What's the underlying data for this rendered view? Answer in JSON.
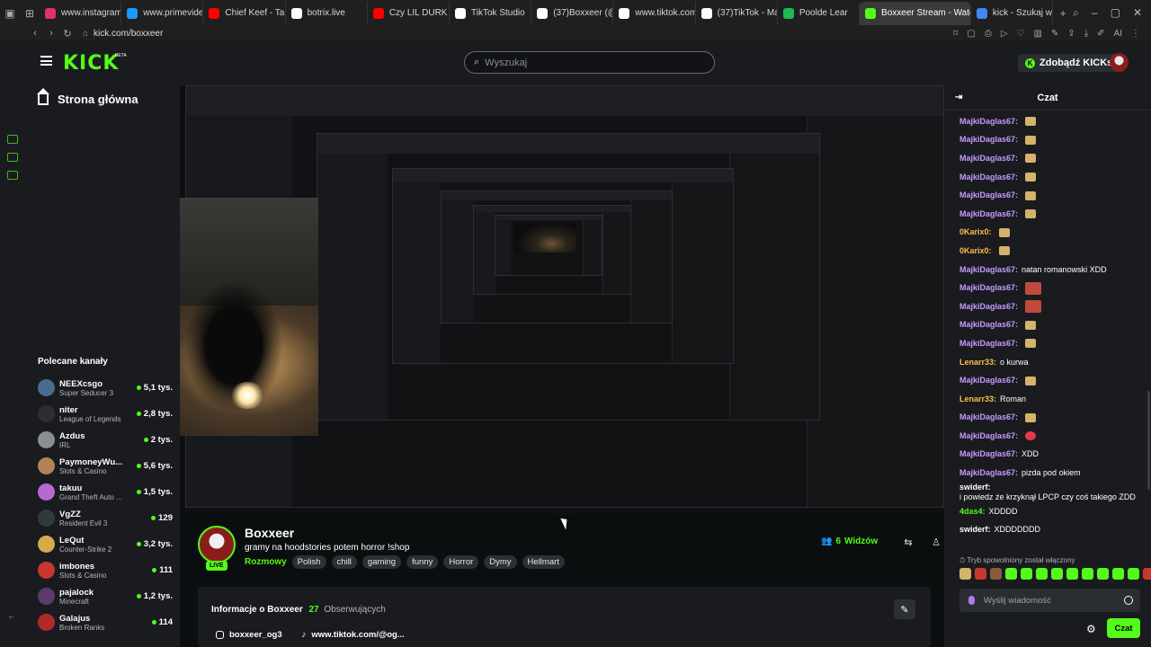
{
  "browser": {
    "tabs": [
      {
        "label": "www.instagram",
        "color": "#e1306c",
        "active": false
      },
      {
        "label": "www.primevide",
        "color": "#1a98ff",
        "active": false
      },
      {
        "label": "Chief Keef - Tal",
        "color": "#ff0000",
        "active": false
      },
      {
        "label": "botrix.live",
        "color": "#ffffff",
        "active": false
      },
      {
        "label": "Czy LIL DURK z",
        "color": "#ff0000",
        "active": false
      },
      {
        "label": "TikTok Studio",
        "color": "#ffffff",
        "active": false
      },
      {
        "label": "(37)Boxxeer (@",
        "color": "#ffffff",
        "active": false
      },
      {
        "label": "www.tiktok.com",
        "color": "#ffffff",
        "active": false
      },
      {
        "label": "(37)TikTok - Ma",
        "color": "#ffffff",
        "active": false
      },
      {
        "label": "Poolde Lear",
        "color": "#1db954",
        "active": false
      },
      {
        "label": "Boxxeer Stream - Watch L",
        "color": "#53fc18",
        "active": true
      },
      {
        "label": "kick - Szukaj w",
        "color": "#4285f4",
        "active": false
      }
    ],
    "url": "kick.com/boxxeer",
    "ext_ai": "AI"
  },
  "header": {
    "logo": "KICK",
    "logo_beta": "BETA",
    "search_placeholder": "Wyszukaj",
    "get_kicks": "Zdobądź KICKs",
    "kicks_k": "K"
  },
  "sidebar": {
    "home": "Strona główna",
    "recommended_title": "Polecane kanały",
    "channels": [
      {
        "name": "NEEXcsgo",
        "category": "Super Seducer 3",
        "viewers": "5,1 tys.",
        "color": "#4a6c8f"
      },
      {
        "name": "niter",
        "category": "League of Legends",
        "viewers": "2,8 tys.",
        "color": "#2e2e2e"
      },
      {
        "name": "Azdus",
        "category": "IRL",
        "viewers": "2 tys.",
        "color": "#8b8f93"
      },
      {
        "name": "PaymoneyWu...",
        "category": "Slots & Casino",
        "viewers": "5,6 tys.",
        "color": "#b0835a"
      },
      {
        "name": "takuu",
        "category": "Grand Theft Auto ...",
        "viewers": "1,5 tys.",
        "color": "#b46ad1"
      },
      {
        "name": "VgZZ",
        "category": "Resident Evil 3",
        "viewers": "129",
        "color": "#2f3a40"
      },
      {
        "name": "LeQut",
        "category": "Counter-Strike 2",
        "viewers": "3,2 tys.",
        "color": "#d9a94a"
      },
      {
        "name": "imbones",
        "category": "Slots & Casino",
        "viewers": "111",
        "color": "#c7372f"
      },
      {
        "name": "pajalock",
        "category": "Minecraft",
        "viewers": "1,2 tys.",
        "color": "#5b3a6e"
      },
      {
        "name": "Galajus",
        "category": "Broken Ranks",
        "viewers": "114",
        "color": "#b02a2a"
      }
    ]
  },
  "stream": {
    "streamer": "Boxxeer",
    "title": "gramy na hoodstories  potem  horror !shop",
    "live": "LIVE",
    "category": "Rozmowy",
    "tags": [
      "Polish",
      "chill",
      "gaming",
      "funny",
      "Horror",
      "Dymy",
      "Hellmart"
    ],
    "viewers": "6",
    "viewers_label": "Widzów",
    "about_title": "Informacje o Boxxeer",
    "followers": "27",
    "followers_label": "Obserwujących",
    "instagram": "boxxeer_og3",
    "tiktok": "www.tiktok.com/@og..."
  },
  "chat": {
    "title": "Czat",
    "messages": [
      {
        "user": "MajkiDaglas67:",
        "text": "",
        "color": "#c69bff",
        "emote": "gold"
      },
      {
        "user": "MajkiDaglas67:",
        "text": "",
        "color": "#c69bff",
        "emote": "gold"
      },
      {
        "user": "MajkiDaglas67:",
        "text": "",
        "color": "#c69bff",
        "emote": "gold"
      },
      {
        "user": "MajkiDaglas67:",
        "text": "",
        "color": "#c69bff",
        "emote": "gold"
      },
      {
        "user": "MajkiDaglas67:",
        "text": "",
        "color": "#c69bff",
        "emote": "gold"
      },
      {
        "user": "MajkiDaglas67:",
        "text": "",
        "color": "#c69bff",
        "emote": "gold"
      },
      {
        "user": "0Karix0:",
        "text": "",
        "color": "#ffbd44",
        "emote": "gold"
      },
      {
        "user": "0Karix0:",
        "text": "",
        "color": "#ffbd44",
        "emote": "gold"
      },
      {
        "user": "MajkiDaglas67:",
        "text": "natan romanowski XDD",
        "color": "#c69bff",
        "emote": ""
      },
      {
        "user": "MajkiDaglas67:",
        "text": "",
        "color": "#c69bff",
        "emote": "red"
      },
      {
        "user": "MajkiDaglas67:",
        "text": "",
        "color": "#c69bff",
        "emote": "red"
      },
      {
        "user": "MajkiDaglas67:",
        "text": "",
        "color": "#c69bff",
        "emote": "gold"
      },
      {
        "user": "MajkiDaglas67:",
        "text": "",
        "color": "#c69bff",
        "emote": "gold"
      },
      {
        "user": "Lenarr33:",
        "text": "o kurwa",
        "color": "#ffbd44",
        "emote": ""
      },
      {
        "user": "MajkiDaglas67:",
        "text": "",
        "color": "#c69bff",
        "emote": "gold"
      },
      {
        "user": "Lenarr33:",
        "text": "Roman",
        "color": "#ffbd44",
        "emote": ""
      },
      {
        "user": "MajkiDaglas67:",
        "text": "",
        "color": "#c69bff",
        "emote": "gold"
      },
      {
        "user": "MajkiDaglas67:",
        "text": "",
        "color": "#c69bff",
        "emote": "rose"
      },
      {
        "user": "MajkiDaglas67:",
        "text": "XDD",
        "color": "#c69bff",
        "emote": ""
      },
      {
        "user": "MajkiDaglas67:",
        "text": "pizda pod okiem",
        "color": "#c69bff",
        "emote": ""
      },
      {
        "user": "swiderf:",
        "text": "i powiedz że krzyknął LPCP czy coś takiego ZDD",
        "color": "#ffffff",
        "emote": ""
      },
      {
        "user": "4das4:",
        "text": "XDDDD",
        "color": "#53fc18",
        "emote": ""
      },
      {
        "user": "swiderf:",
        "text": "XDDDDDDD",
        "color": "#ffffff",
        "emote": ""
      }
    ],
    "slow_mode": "Tryb spowolniony został włączony",
    "input_placeholder": "Wyślij wiadomość",
    "send": "Czat"
  }
}
